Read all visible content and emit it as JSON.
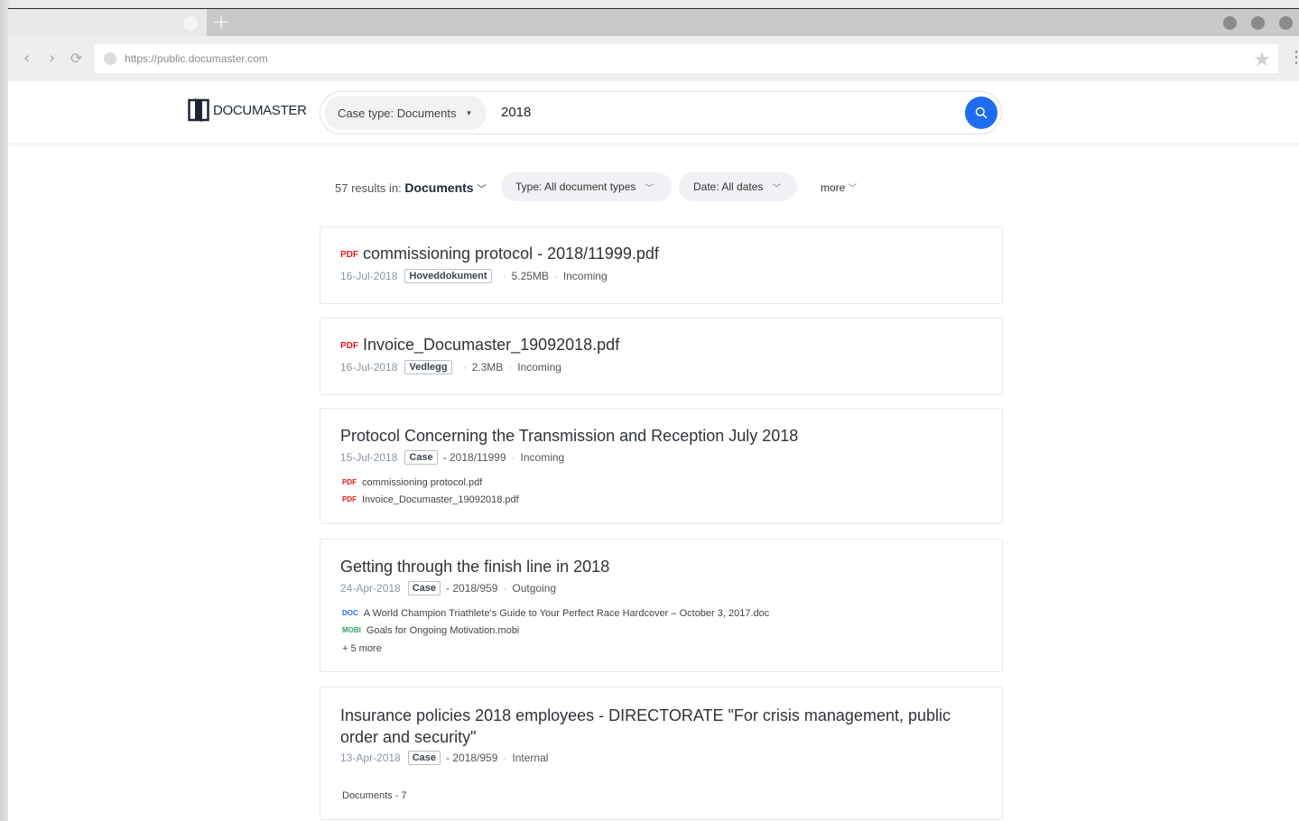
{
  "browser": {
    "url": "https://public.documaster.com",
    "new_tab_icon": "plus-icon"
  },
  "app": {
    "logo_text": "DOCUMASTER",
    "search": {
      "case_type_label": "Case type: Documents",
      "query": "2018"
    }
  },
  "filters": {
    "results_prefix": "57 results in:",
    "scope": "Documents",
    "type_chip": "Type: All document types",
    "date_chip": "Date: All dates",
    "more_label": "more"
  },
  "results": [
    {
      "file_type": "PDF",
      "title": "commissioning protocol - 2018/11999.pdf",
      "date": "16-Jul-2018",
      "badge": "Hoveddokument",
      "size": "5.25MB",
      "direction": "Incoming"
    },
    {
      "file_type": "PDF",
      "title": "Invoice_Documaster_19092018.pdf",
      "date": "16-Jul-2018",
      "badge": "Vedlegg",
      "size": "2.3MB",
      "direction": "Incoming"
    },
    {
      "title": "Protocol Concerning the Transmission and Reception July 2018",
      "date": "15-Jul-2018",
      "badge": "Case",
      "case_no": "- 2018/11999",
      "direction": "Incoming",
      "attachments": [
        {
          "type": "PDF",
          "name": "commissioning protocol.pdf"
        },
        {
          "type": "PDF",
          "name": "Invoice_Documaster_19092018.pdf"
        }
      ]
    },
    {
      "title": "Getting through the finish line in 2018",
      "date": "24-Apr-2018",
      "badge": "Case",
      "case_no": "- 2018/959",
      "direction": "Outgoing",
      "attachments": [
        {
          "type": "DOC",
          "name": "A World Champion Triathlete's Guide to Your Perfect Race Hardcover – October 3, 2017.doc"
        },
        {
          "type": "MOBI",
          "name": "Goals for Ongoing Motivation.mobi"
        }
      ],
      "more_label": "+ 5 more"
    },
    {
      "title": "Insurance policies 2018 employees - DIRECTORATE \"For crisis management, public order and security\"",
      "date": "13-Apr-2018",
      "badge": "Case",
      "case_no": "- 2018/959",
      "direction": "Internal",
      "documents_label": "Documents - 7"
    }
  ],
  "colors": {
    "accent": "#1f6cf0",
    "pdf": "#e8191e",
    "doc": "#2a6de0",
    "mobi": "#2ba36a"
  }
}
